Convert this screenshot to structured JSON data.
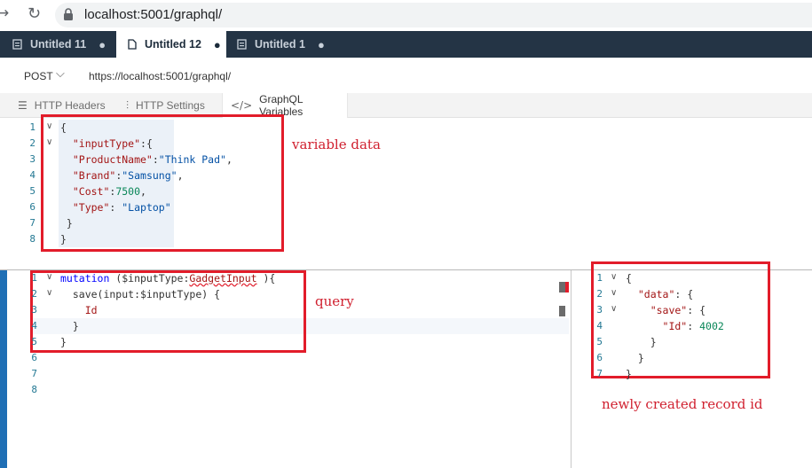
{
  "browser": {
    "url": "localhost:5001/graphql/"
  },
  "tabs": [
    {
      "label": "Untitled 11",
      "dot": "●"
    },
    {
      "label": "Untitled 12",
      "dot": "●"
    },
    {
      "label": "Untitled 1",
      "dot": "●"
    }
  ],
  "request": {
    "method": "POST",
    "url": "https://localhost:5001/graphql/"
  },
  "subtabs": [
    {
      "label": "HTTP Headers",
      "icon": "menu-icon"
    },
    {
      "label": "HTTP Settings",
      "icon": "sliders-icon"
    },
    {
      "label": "GraphQL Variables",
      "icon": "code-icon"
    }
  ],
  "variables_editor": {
    "line_numbers": [
      "1",
      "2",
      "3",
      "4",
      "5",
      "6",
      "7",
      "8"
    ],
    "lines": [
      [
        {
          "t": "{",
          "c": "plain"
        }
      ],
      [
        {
          "t": "  \"inputType\"",
          "c": "key"
        },
        {
          "t": ":{",
          "c": "plain"
        }
      ],
      [
        {
          "t": "  \"ProductName\"",
          "c": "key"
        },
        {
          "t": ":",
          "c": "plain"
        },
        {
          "t": "\"Think Pad\"",
          "c": "str"
        },
        {
          "t": ",",
          "c": "plain"
        }
      ],
      [
        {
          "t": "  \"Brand\"",
          "c": "key"
        },
        {
          "t": ":",
          "c": "plain"
        },
        {
          "t": "\"Samsung\"",
          "c": "str"
        },
        {
          "t": ",",
          "c": "plain"
        }
      ],
      [
        {
          "t": "  \"Cost\"",
          "c": "key"
        },
        {
          "t": ":",
          "c": "plain"
        },
        {
          "t": "7500",
          "c": "num"
        },
        {
          "t": ",",
          "c": "plain"
        }
      ],
      [
        {
          "t": "  \"Type\"",
          "c": "key"
        },
        {
          "t": ": ",
          "c": "plain"
        },
        {
          "t": "\"Laptop\"",
          "c": "str"
        }
      ],
      [
        {
          "t": " }",
          "c": "plain"
        }
      ],
      [
        {
          "t": "}",
          "c": "plain"
        }
      ]
    ]
  },
  "query_editor": {
    "line_numbers": [
      "1",
      "2",
      "3",
      "4",
      "5",
      "6",
      "7",
      "8"
    ],
    "lines": [
      [
        {
          "t": "mutation",
          "c": "kw"
        },
        {
          "t": " ($inputType:",
          "c": "plain"
        },
        {
          "t": "GadgetInput",
          "c": "key"
        },
        {
          "t": " ){",
          "c": "plain"
        }
      ],
      [
        {
          "t": "  save(input:$inputType) {",
          "c": "plain"
        }
      ],
      [
        {
          "t": "    Id",
          "c": "key"
        }
      ],
      [
        {
          "t": "  }",
          "c": "plain"
        }
      ],
      [
        {
          "t": "}",
          "c": "plain"
        }
      ],
      [],
      [],
      []
    ]
  },
  "response_editor": {
    "line_numbers": [
      "1",
      "2",
      "3",
      "4",
      "5",
      "6",
      "7"
    ],
    "lines": [
      [
        {
          "t": "{",
          "c": "plain"
        }
      ],
      [
        {
          "t": "  \"data\"",
          "c": "key"
        },
        {
          "t": ": {",
          "c": "plain"
        }
      ],
      [
        {
          "t": "    \"save\"",
          "c": "key"
        },
        {
          "t": ": {",
          "c": "plain"
        }
      ],
      [
        {
          "t": "      \"Id\"",
          "c": "key"
        },
        {
          "t": ": ",
          "c": "plain"
        },
        {
          "t": "4002",
          "c": "num"
        }
      ],
      [
        {
          "t": "    }",
          "c": "plain"
        }
      ],
      [
        {
          "t": "  }",
          "c": "plain"
        }
      ],
      [
        {
          "t": "}",
          "c": "plain"
        }
      ]
    ]
  },
  "annotations": {
    "variable_data": "variable data",
    "query": "query",
    "record_id": "newly created record id"
  },
  "colors": {
    "annotation": "#e21c2a",
    "tab_strip": "#243445",
    "accent": "#1f6fb5"
  }
}
